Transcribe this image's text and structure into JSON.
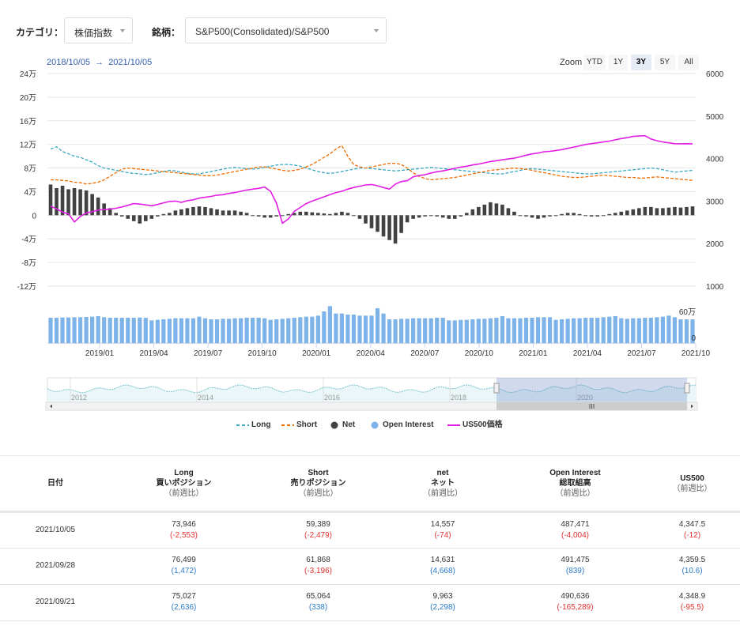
{
  "filters": {
    "category_label": "カテゴリ：",
    "category_value": "株価指数",
    "symbol_label": "銘柄：",
    "symbol_value": "S&P500(Consolidated)/S&P500"
  },
  "range": {
    "from": "2018/10/05",
    "arrow": "→",
    "to": "2021/10/05"
  },
  "zoom": {
    "label": "Zoom",
    "buttons": [
      "YTD",
      "1Y",
      "3Y",
      "5Y",
      "All"
    ],
    "active": "3Y"
  },
  "chart_data": {
    "type": "line",
    "left_axis_ticks": [
      "24万",
      "20万",
      "16万",
      "12万",
      "8万",
      "4万",
      "0",
      "-4万",
      "-8万",
      "-12万"
    ],
    "right_axis_ticks": [
      "6000",
      "5000",
      "4000",
      "3000",
      "2000",
      "1000"
    ],
    "volume_axis_ticks": [
      "60万",
      "0"
    ],
    "x_ticks": [
      "2019/01",
      "2019/04",
      "2019/07",
      "2019/10",
      "2020/01",
      "2020/04",
      "2020/07",
      "2020/10",
      "2021/01",
      "2021/04",
      "2021/07",
      "2021/10"
    ],
    "navigator_ticks": [
      "2012",
      "2014",
      "2016",
      "2018",
      "2020"
    ],
    "x_range": [
      "2018/10/05",
      "2021/10/05"
    ],
    "left_range": [
      -120000,
      240000
    ],
    "right_range": [
      1000,
      6000
    ],
    "volume_range": [
      0,
      600000
    ],
    "series": [
      {
        "name": "Long",
        "color": "#3aa8c1",
        "dash": true,
        "axis": "left",
        "values": [
          112000,
          116000,
          108000,
          104000,
          100000,
          98000,
          94000,
          90000,
          84000,
          80000,
          78000,
          76000,
          74000,
          72000,
          71000,
          70000,
          69000,
          70000,
          72000,
          74000,
          76000,
          75000,
          73000,
          71000,
          70000,
          70000,
          72000,
          74000,
          76000,
          78000,
          80000,
          81000,
          80000,
          79000,
          78000,
          79000,
          81000,
          83000,
          85000,
          86000,
          86000,
          85000,
          83000,
          80000,
          77000,
          74000,
          72000,
          71000,
          72000,
          74000,
          76000,
          78000,
          80000,
          80000,
          79000,
          78000,
          77000,
          76000,
          75000,
          76000,
          77000,
          78000,
          79000,
          80000,
          81000,
          80000,
          79000,
          78000,
          77000,
          76000,
          75000,
          74000,
          73000,
          72000,
          71000,
          70000,
          70000,
          72000,
          74000,
          76000,
          78000,
          79000,
          78000,
          77000,
          76000,
          75000,
          74000,
          73000,
          72000,
          71000,
          70000,
          70000,
          71000,
          72000,
          73000,
          74000,
          75000,
          76000,
          77000,
          78000,
          79000,
          80000,
          79000,
          77000,
          75000,
          73000,
          74000,
          75000,
          76000
        ]
      },
      {
        "name": "Short",
        "color": "#ef6c00",
        "dash": true,
        "axis": "left",
        "values": [
          60000,
          60000,
          59000,
          58000,
          56000,
          55000,
          53000,
          54000,
          56000,
          60000,
          66000,
          72000,
          78000,
          80000,
          79000,
          78000,
          77000,
          76000,
          75000,
          74000,
          73000,
          72000,
          71000,
          70000,
          69000,
          68000,
          67000,
          67000,
          68000,
          70000,
          72000,
          74000,
          76000,
          78000,
          80000,
          82000,
          82000,
          80000,
          78000,
          76000,
          75000,
          76000,
          78000,
          82000,
          86000,
          92000,
          98000,
          104000,
          112000,
          118000,
          100000,
          86000,
          82000,
          80000,
          82000,
          84000,
          86000,
          88000,
          88000,
          86000,
          80000,
          72000,
          66000,
          62000,
          60000,
          61000,
          62000,
          63000,
          64000,
          66000,
          68000,
          70000,
          72000,
          74000,
          76000,
          77000,
          78000,
          79000,
          80000,
          79000,
          78000,
          76000,
          74000,
          72000,
          70000,
          68000,
          66000,
          65000,
          64000,
          64000,
          65000,
          66000,
          67000,
          68000,
          67000,
          66000,
          65000,
          64000,
          64000,
          63000,
          63000,
          64000,
          65000,
          64000,
          63000,
          62000,
          61000,
          60000,
          59000
        ]
      },
      {
        "name": "Net",
        "color": "#424242",
        "type": "bar",
        "axis": "left",
        "values": [
          52000,
          46000,
          50000,
          44000,
          46000,
          44000,
          42000,
          36000,
          30000,
          20000,
          12000,
          4000,
          -2000,
          -6000,
          -10000,
          -14000,
          -10000,
          -6000,
          -2000,
          2000,
          4000,
          8000,
          10000,
          12000,
          14000,
          15000,
          14000,
          12000,
          10000,
          8000,
          8000,
          8000,
          6000,
          4000,
          0,
          -2000,
          -4000,
          -4000,
          -2000,
          0,
          2000,
          4000,
          6000,
          6000,
          5000,
          4000,
          3000,
          2000,
          4000,
          6000,
          4000,
          0,
          -6000,
          -14000,
          -22000,
          -28000,
          -36000,
          -42000,
          -48000,
          -30000,
          -12000,
          -6000,
          -4000,
          -2000,
          0,
          -2000,
          -4000,
          -6000,
          -6000,
          -2000,
          4000,
          10000,
          14000,
          18000,
          22000,
          20000,
          18000,
          12000,
          6000,
          0,
          -2000,
          -4000,
          -6000,
          -4000,
          -2000,
          0,
          2000,
          4000,
          4000,
          2000,
          0,
          -2000,
          -2000,
          0,
          2000,
          4000,
          6000,
          8000,
          10000,
          12000,
          14000,
          14000,
          12000,
          12000,
          13000,
          14000,
          13000,
          14000,
          15000
        ]
      },
      {
        "name": "Open Interest",
        "color": "#7db3e8",
        "type": "bar",
        "axis": "volume",
        "values": [
          480000,
          480000,
          485000,
          485000,
          490000,
          490000,
          495000,
          500000,
          510000,
          490000,
          480000,
          480000,
          480000,
          480000,
          480000,
          485000,
          480000,
          430000,
          440000,
          450000,
          460000,
          470000,
          470000,
          470000,
          470000,
          500000,
          470000,
          450000,
          450000,
          460000,
          460000,
          470000,
          470000,
          480000,
          480000,
          480000,
          470000,
          440000,
          450000,
          460000,
          470000,
          480000,
          490000,
          500000,
          500000,
          520000,
          600000,
          700000,
          560000,
          560000,
          540000,
          540000,
          520000,
          520000,
          520000,
          660000,
          560000,
          450000,
          450000,
          460000,
          460000,
          470000,
          470000,
          470000,
          470000,
          480000,
          480000,
          430000,
          430000,
          440000,
          440000,
          450000,
          460000,
          460000,
          470000,
          480000,
          510000,
          470000,
          470000,
          470000,
          480000,
          480000,
          490000,
          490000,
          490000,
          440000,
          450000,
          460000,
          470000,
          470000,
          480000,
          480000,
          480000,
          490000,
          500000,
          510000,
          470000,
          460000,
          470000,
          470000,
          480000,
          480000,
          490000,
          500000,
          520000,
          490000,
          450000,
          450000,
          450000
        ]
      },
      {
        "name": "US500価格",
        "color": "#e21ee6",
        "dash": false,
        "axis": "right",
        "values": [
          2880,
          2820,
          2740,
          2700,
          2510,
          2640,
          2720,
          2750,
          2790,
          2800,
          2810,
          2830,
          2860,
          2900,
          2940,
          2930,
          2910,
          2890,
          2920,
          2960,
          2990,
          3000,
          2970,
          3010,
          3030,
          3070,
          3090,
          3110,
          3140,
          3150,
          3180,
          3200,
          3230,
          3260,
          3280,
          3300,
          3330,
          3230,
          2950,
          2480,
          2580,
          2760,
          2850,
          2940,
          3000,
          3050,
          3100,
          3150,
          3200,
          3230,
          3280,
          3320,
          3350,
          3380,
          3390,
          3360,
          3320,
          3280,
          3400,
          3460,
          3480,
          3570,
          3600,
          3620,
          3660,
          3690,
          3710,
          3740,
          3770,
          3800,
          3820,
          3850,
          3870,
          3900,
          3930,
          3950,
          3970,
          3990,
          4010,
          4040,
          4080,
          4110,
          4130,
          4160,
          4170,
          4190,
          4210,
          4240,
          4270,
          4300,
          4330,
          4350,
          4370,
          4390,
          4410,
          4440,
          4470,
          4490,
          4520,
          4530,
          4537,
          4460,
          4420,
          4390,
          4370,
          4350,
          4347.5,
          4350,
          4347
        ]
      }
    ]
  },
  "table": {
    "headers": [
      {
        "line1": "日付",
        "line2": "",
        "line3": ""
      },
      {
        "line1": "Long",
        "line2": "買いポジション",
        "line3": "（前週比）"
      },
      {
        "line1": "Short",
        "line2": "売りポジション",
        "line3": "（前週比）"
      },
      {
        "line1": "net",
        "line2": "ネット",
        "line3": "（前週比）"
      },
      {
        "line1": "Open Interest",
        "line2": "総取組高",
        "line3": "（前週比）"
      },
      {
        "line1": "US500",
        "line2": "（前週比）",
        "line3": ""
      }
    ],
    "rows": [
      {
        "date": "2021/10/05",
        "long": "73,946",
        "long_chg": "(-2,553)",
        "long_sign": "neg",
        "short": "59,389",
        "short_chg": "(-2,479)",
        "short_sign": "neg",
        "net": "14,557",
        "net_chg": "(-74)",
        "net_sign": "neg",
        "oi": "487,471",
        "oi_chg": "(-4,004)",
        "oi_sign": "neg",
        "us500": "4,347.5",
        "us500_chg": "(-12)",
        "us500_sign": "neg"
      },
      {
        "date": "2021/09/28",
        "long": "76,499",
        "long_chg": "(1,472)",
        "long_sign": "pos",
        "short": "61,868",
        "short_chg": "(-3,196)",
        "short_sign": "neg",
        "net": "14,631",
        "net_chg": "(4,668)",
        "net_sign": "pos",
        "oi": "491,475",
        "oi_chg": "(839)",
        "oi_sign": "pos",
        "us500": "4,359.5",
        "us500_chg": "(10.6)",
        "us500_sign": "pos"
      },
      {
        "date": "2021/09/21",
        "long": "75,027",
        "long_chg": "(2,636)",
        "long_sign": "pos",
        "short": "65,064",
        "short_chg": "(338)",
        "short_sign": "pos",
        "net": "9,963",
        "net_chg": "(2,298)",
        "net_sign": "pos",
        "oi": "490,636",
        "oi_chg": "(-165,289)",
        "oi_sign": "neg",
        "us500": "4,348.9",
        "us500_chg": "(-95.5)",
        "us500_sign": "neg"
      }
    ]
  }
}
